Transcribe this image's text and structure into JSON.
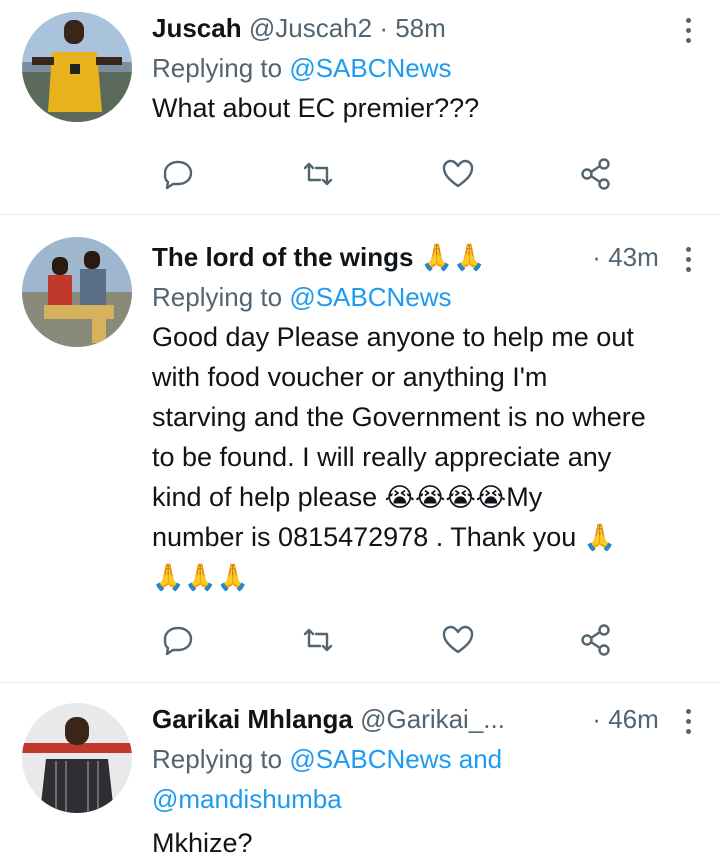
{
  "tweets": [
    {
      "name": "Juscah",
      "handle": "@Juscah2",
      "separator": "·",
      "time": "58m",
      "replying_prefix": "Replying to",
      "replying_to": "@SABCNews",
      "text": "What about EC premier???"
    },
    {
      "name": "The lord of the wings",
      "name_emoji": "🙏🙏",
      "separator": "·",
      "time": "43m",
      "replying_prefix": "Replying to",
      "replying_to": "@SABCNews",
      "text_lines": [
        "Good day Please anyone to help me out",
        "with food voucher or anything I'm",
        "starving and the Government is no where",
        "to be found. I will really appreciate any"
      ],
      "text_line5_start": "kind of help please ",
      "text_line5_emoji": "😭😭😭😭",
      "text_line5_end": "My",
      "text_line6": "number is 0815472978 . Thank you ",
      "text_line6_emoji": "🙏",
      "text_line7_emoji": "🙏🙏🙏"
    },
    {
      "name": "Garikai Mhlanga",
      "handle": "@Garikai_...",
      "separator": "·",
      "time": "46m",
      "replying_prefix": "Replying to",
      "replying_to": "@SABCNews and",
      "replying_to_2": "@mandishumba",
      "text": "Mkhize?"
    }
  ],
  "icons": {
    "reply": "reply-icon",
    "retweet": "retweet-icon",
    "like": "heart-icon",
    "share": "share-icon",
    "more": "more-vertical-icon"
  },
  "colors": {
    "link": "#1d9bf0",
    "secondary_text": "#536471",
    "divider": "#e6ecf0"
  }
}
